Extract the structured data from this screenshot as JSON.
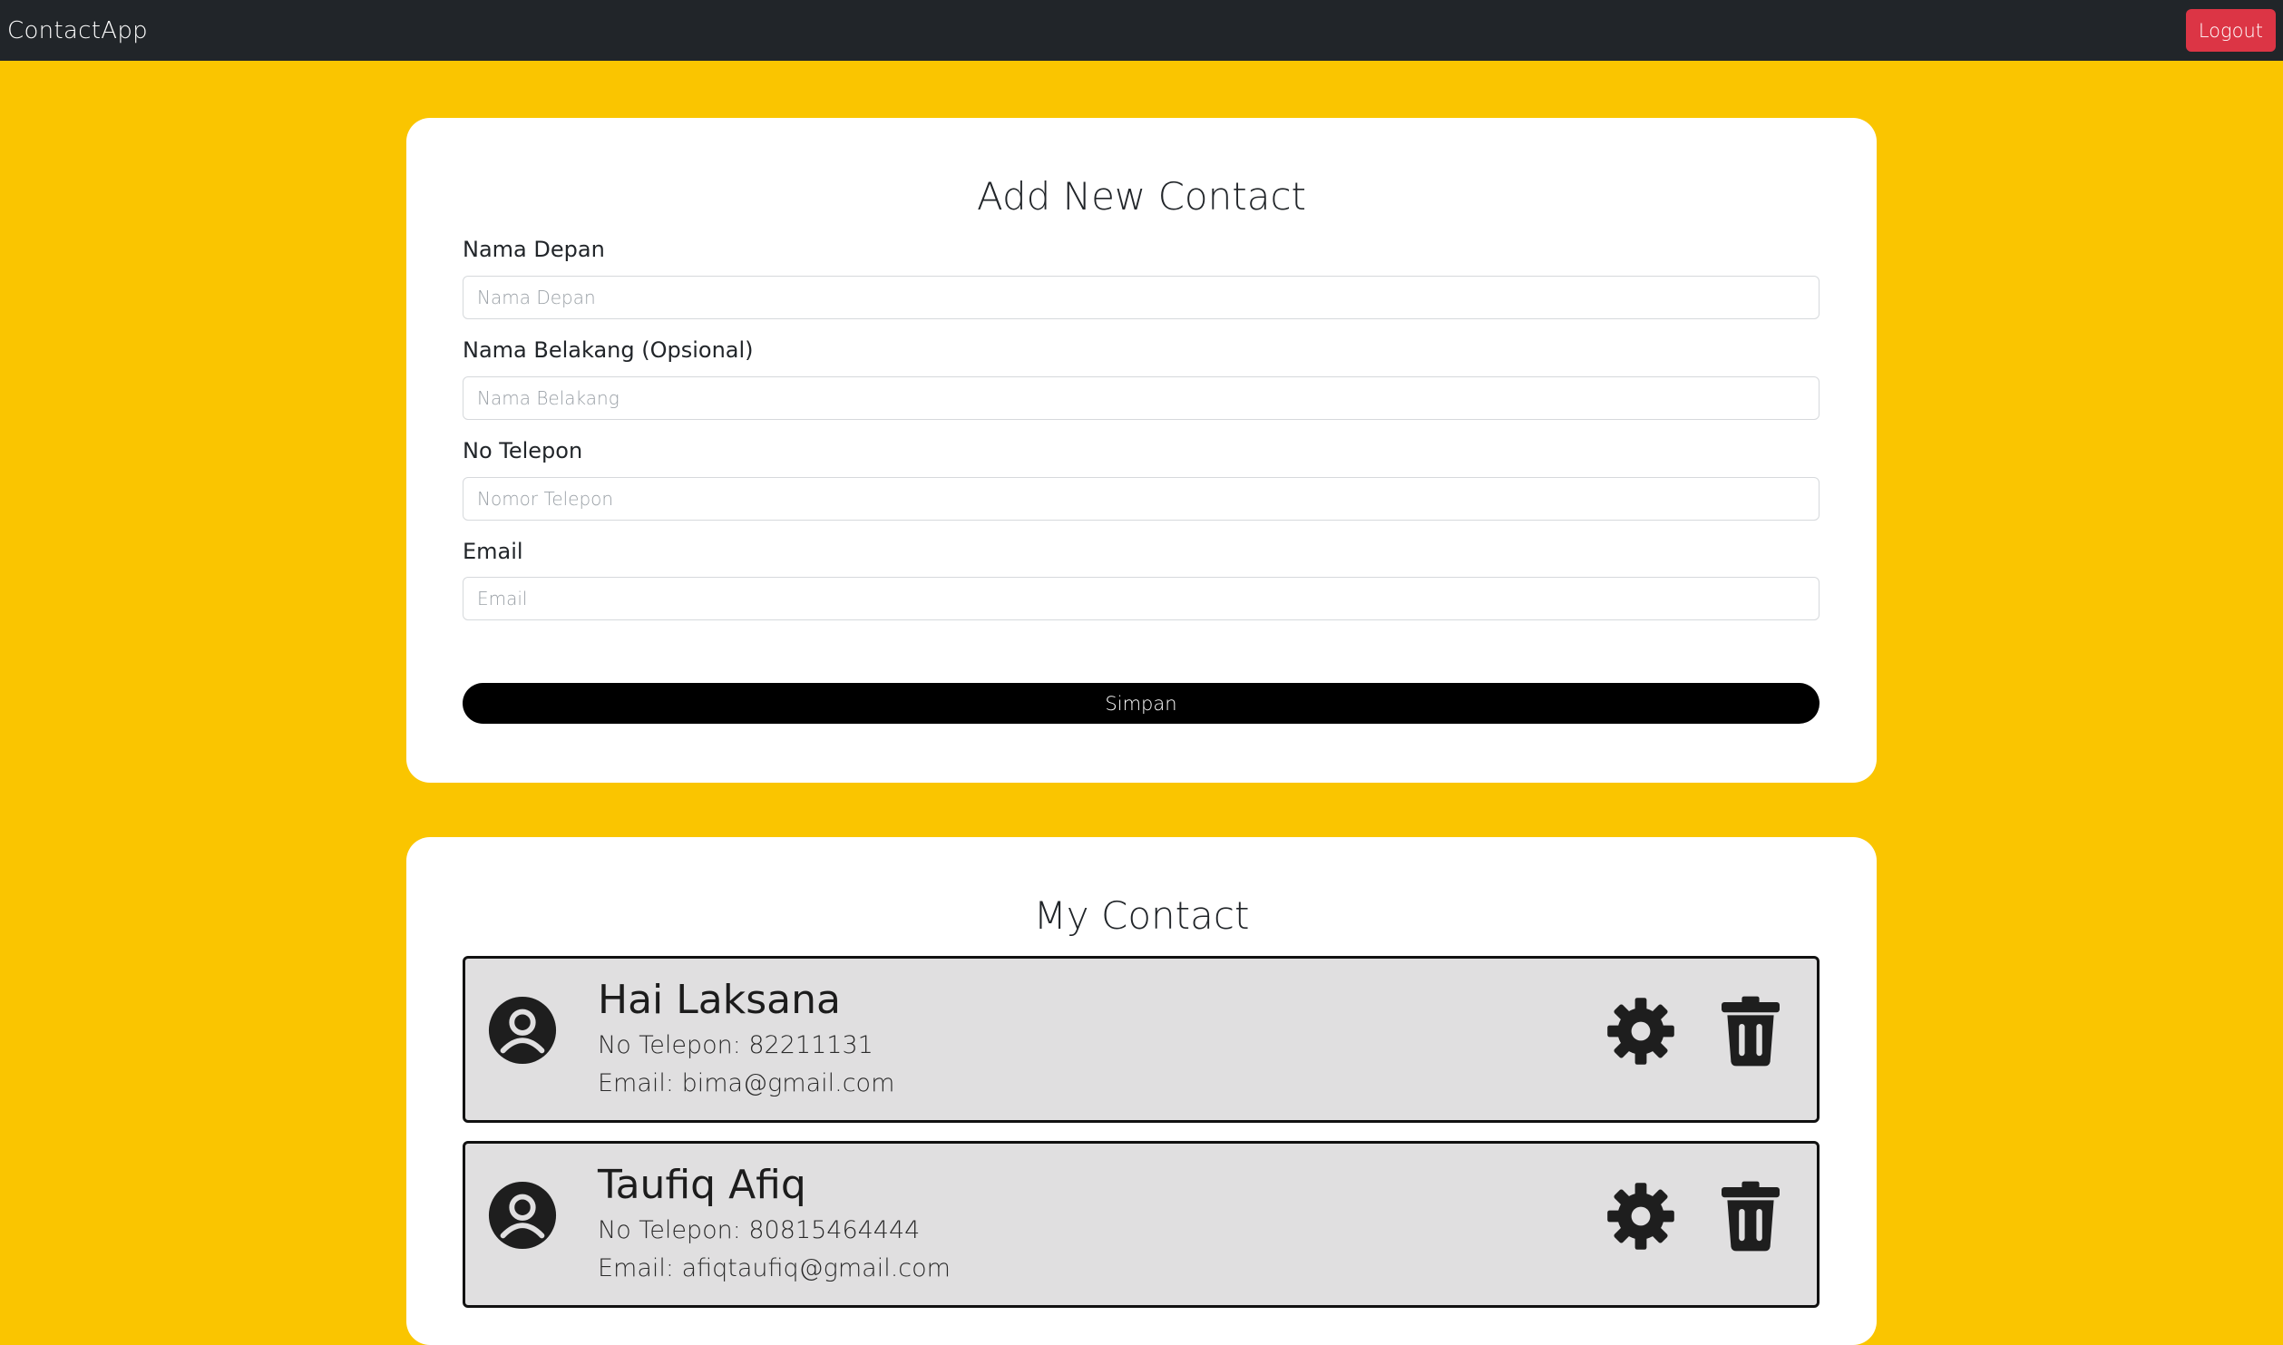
{
  "navbar": {
    "brand": "ContactApp",
    "logout_label": "Logout"
  },
  "form": {
    "title": "Add New Contact",
    "fields": [
      {
        "label": "Nama Depan",
        "placeholder": "Nama Depan",
        "value": ""
      },
      {
        "label": "Nama Belakang (Opsional)",
        "placeholder": "Nama Belakang",
        "value": ""
      },
      {
        "label": "No Telepon",
        "placeholder": "Nomor Telepon",
        "value": ""
      },
      {
        "label": "Email",
        "placeholder": "Email",
        "value": ""
      }
    ],
    "submit_label": "Simpan"
  },
  "contacts_section": {
    "title": "My Contact",
    "contacts": [
      {
        "name": "Hai Laksana",
        "phone": "No Telepon: 82211131",
        "email": "Email: bima@gmail.com"
      },
      {
        "name": "Taufiq Afiq",
        "phone": "No Telepon: 80815464444",
        "email": "Email: afiqtaufiq@gmail.com"
      }
    ]
  },
  "colors": {
    "page_bg": "#FAC500",
    "navbar_bg": "#212529",
    "logout_bg": "#DC3545",
    "contact_bg": "#E0DFE0"
  },
  "icons": [
    "user-avatar-icon",
    "gear-icon",
    "trash-icon"
  ]
}
